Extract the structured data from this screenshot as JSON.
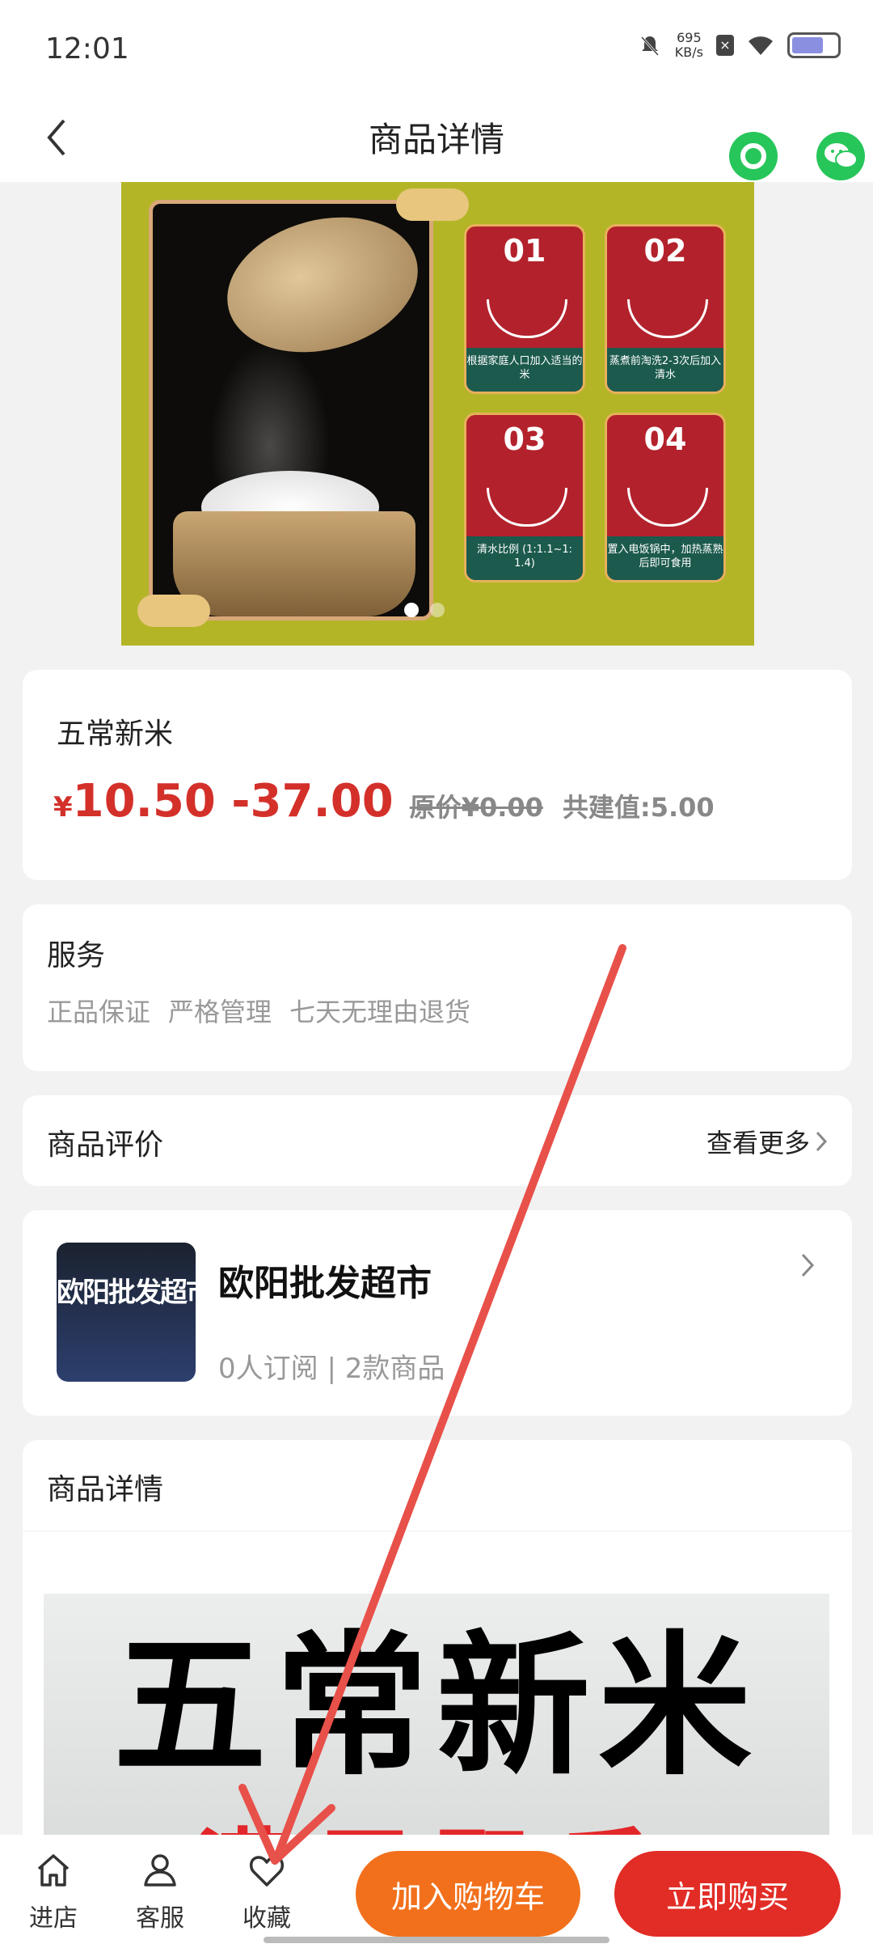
{
  "status_bar": {
    "time": "12:01",
    "net_speed_value": "695",
    "net_speed_unit": "KB/s",
    "battery_level": 0.7
  },
  "header": {
    "title": "商品详情"
  },
  "hero": {
    "steps": [
      {
        "num": "01",
        "caption": "根据家庭人口加入适当的米"
      },
      {
        "num": "02",
        "caption": "蒸煮前淘洗2-3次后加入清水"
      },
      {
        "num": "03",
        "caption": "清水比例 (1:1.1~1: 1.4)"
      },
      {
        "num": "04",
        "caption": "置入电饭锅中，加热蒸熟后即可食用"
      }
    ],
    "slide_count": 2,
    "active_slide": 1
  },
  "product": {
    "name": "五常新米",
    "currency": "¥",
    "price_range": "10.50 -37.00",
    "original_price": "原价¥0.00",
    "coop_value": "共建值:5.00"
  },
  "service": {
    "title": "服务",
    "tags": [
      "正品保证",
      "严格管理",
      "七天无理由退货"
    ]
  },
  "reviews": {
    "title": "商品评价",
    "more": "查看更多"
  },
  "shop": {
    "thumb_text": "欧阳批发超市",
    "name": "欧阳批发超市",
    "meta": "0人订阅 | 2款商品"
  },
  "details": {
    "title": "商品详情",
    "image_headline": "五常新米",
    "image_sub": "满屋飘香"
  },
  "bottom_bar": {
    "nav": [
      {
        "label": "进店",
        "icon": "home-icon"
      },
      {
        "label": "客服",
        "icon": "person-icon"
      },
      {
        "label": "收藏",
        "icon": "heart-icon"
      }
    ],
    "add_to_cart": "加入购物车",
    "buy_now": "立即购买"
  },
  "colors": {
    "price_red": "#d4302a",
    "cart_orange": "#f2701c",
    "buy_red": "#e12d26",
    "share_green": "#27c65a",
    "annotation_red": "#e8504a"
  }
}
